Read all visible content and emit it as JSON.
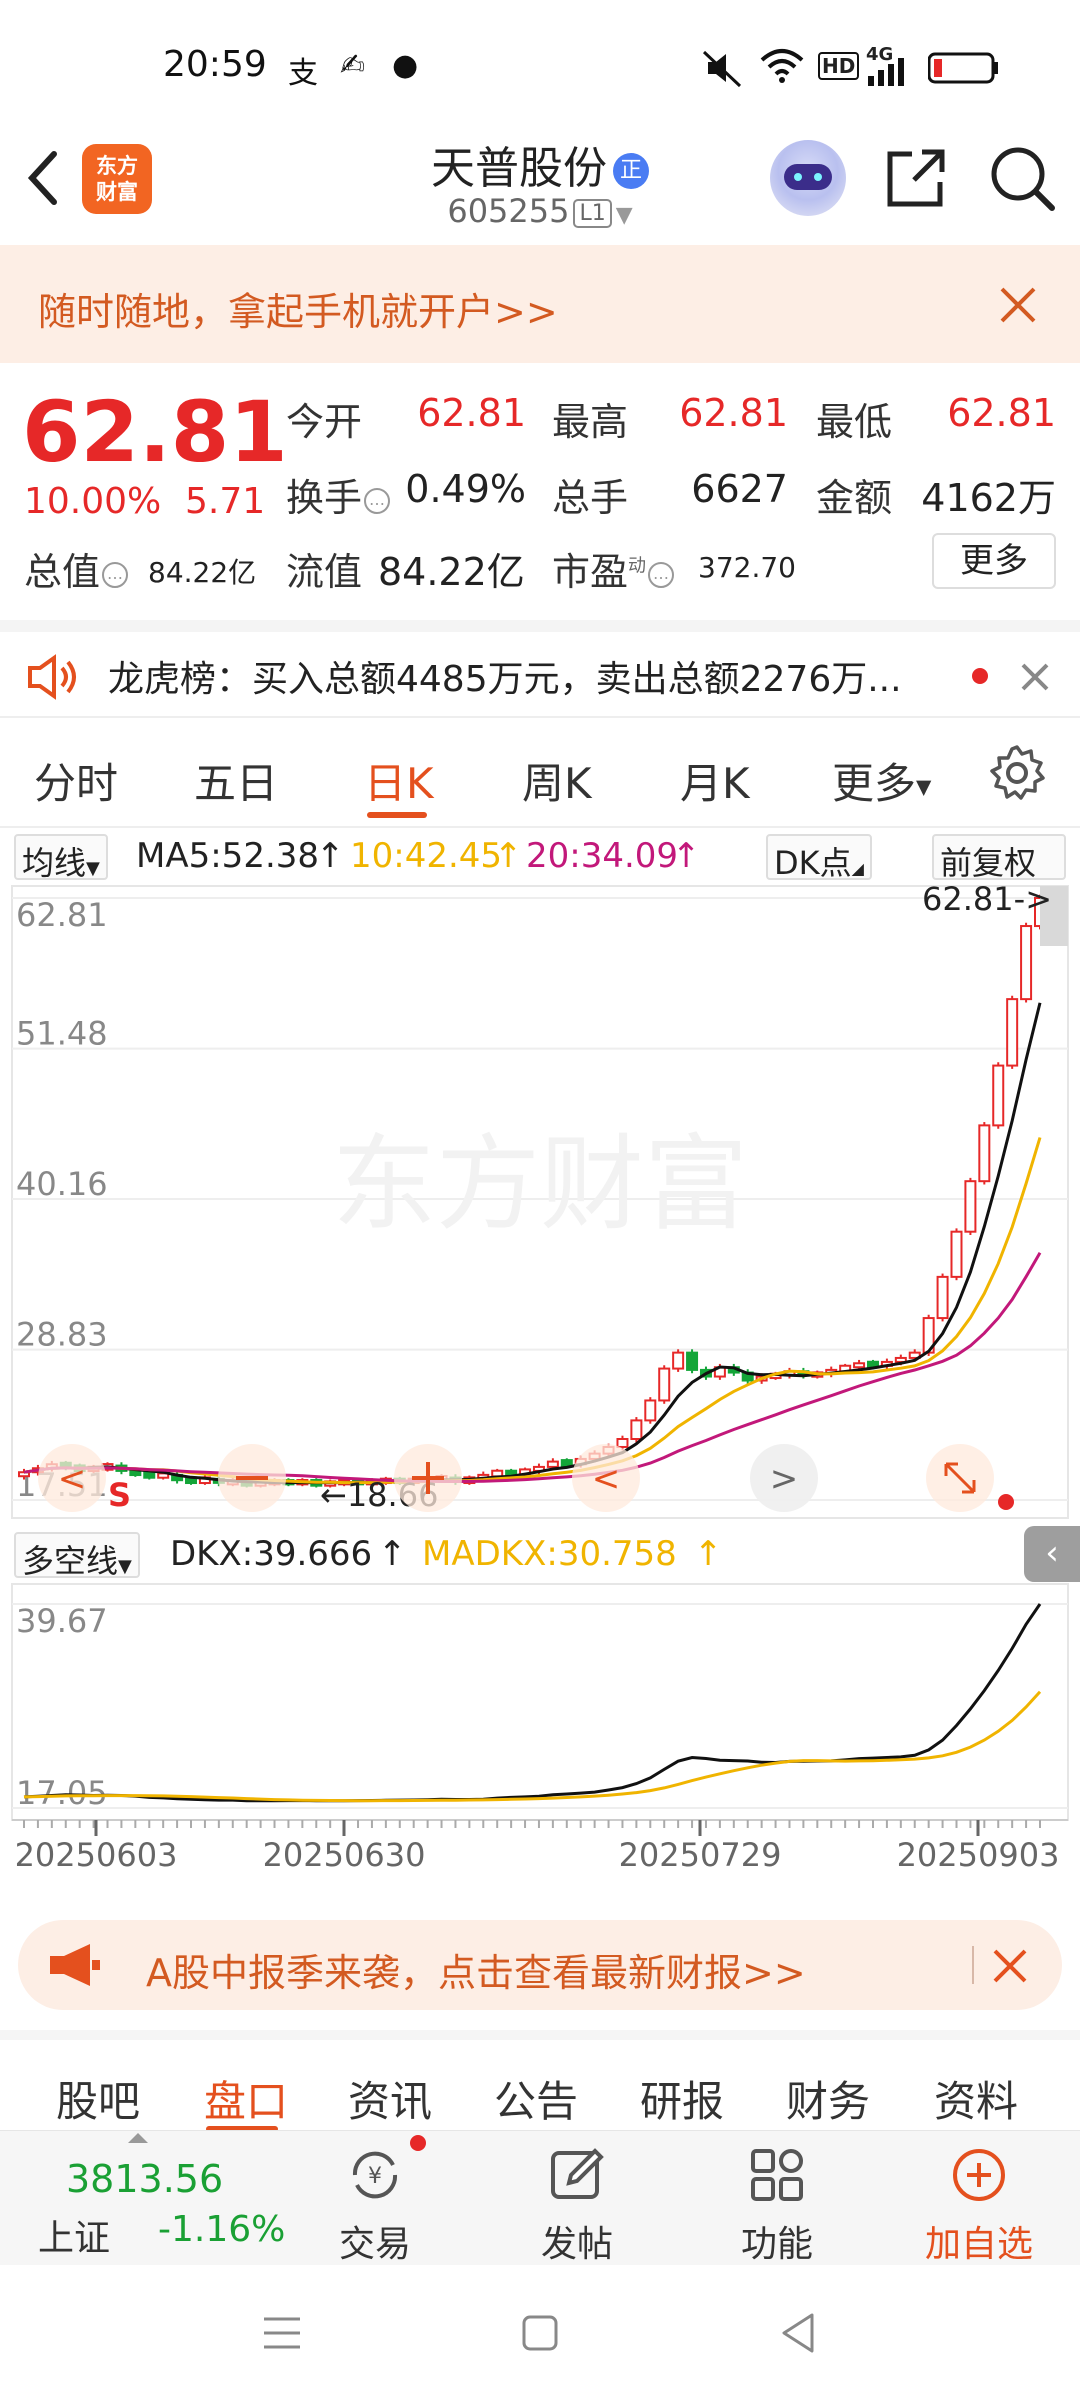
{
  "status_bar": {
    "time": "20:59",
    "network": "4G",
    "hd": "HD"
  },
  "header": {
    "logo_text": [
      "东方",
      "财富"
    ],
    "stock_name": "天普股份",
    "badge": "正",
    "stock_code": "605255",
    "level": "L1"
  },
  "banner_top": {
    "text": "随时随地，拿起手机就开户>>"
  },
  "quote": {
    "price": "62.81",
    "change_pct": "10.00%",
    "change": "5.71",
    "open_label": "今开",
    "open": "62.81",
    "high_label": "最高",
    "high": "62.81",
    "low_label": "最低",
    "low": "62.81",
    "turnover_label": "换手",
    "turnover": "0.49%",
    "volume_label": "总手",
    "volume": "6627",
    "amount_label": "金额",
    "amount": "4162万",
    "mktcap_label": "总值",
    "mktcap": "84.22亿",
    "float_label": "流值",
    "float_cap": "84.22亿",
    "pe_label": "市盈",
    "pe_sup": "动",
    "pe": "372.70",
    "more": "更多"
  },
  "ticker": {
    "text": "龙虎榜：买入总额4485万元，卖出总额2276万..."
  },
  "chart_tabs": [
    "分时",
    "五日",
    "日K",
    "周K",
    "月K",
    "更多"
  ],
  "ma_row": {
    "selector": "均线",
    "ma5": "MA5:52.38",
    "ma10": "10:42.45",
    "ma20": "20:34.09",
    "dk_button": "DK点",
    "adjust_button": "前复权"
  },
  "dkx_row": {
    "selector": "多空线",
    "dkx": "DKX:39.666",
    "madkx": "MADKX:30.758"
  },
  "chart_labels": {
    "current_tag": "62.81->",
    "min_tag": "18.66",
    "s_marker": "S",
    "watermark": "东方财富"
  },
  "chart_data": [
    {
      "type": "candlestick",
      "title": "日K",
      "y_ticks": [
        "62.81",
        "51.48",
        "40.16",
        "28.83",
        "17.51"
      ],
      "ylim": [
        17.51,
        62.81
      ],
      "series": [
        {
          "name": "MA5",
          "color": "#111111"
        },
        {
          "name": "MA10",
          "color": "#f0b400"
        },
        {
          "name": "MA20",
          "color": "#c2187a"
        }
      ],
      "close": [
        19.6,
        19.9,
        20.2,
        20.0,
        19.8,
        19.9,
        20.1,
        19.7,
        19.5,
        19.3,
        19.4,
        19.0,
        18.9,
        19.1,
        18.8,
        18.9,
        18.7,
        18.8,
        18.9,
        18.8,
        18.9,
        18.7,
        18.8,
        18.9,
        18.8,
        18.9,
        19.0,
        18.9,
        19.0,
        19.1,
        19.2,
        18.9,
        19.1,
        19.4,
        19.6,
        19.5,
        19.7,
        20.0,
        20.4,
        20.2,
        20.6,
        21.0,
        21.5,
        22.1,
        23.5,
        25.0,
        27.4,
        28.6,
        27.3,
        26.8,
        27.5,
        27.1,
        26.5,
        26.8,
        26.9,
        27.2,
        26.9,
        27.0,
        27.3,
        27.5,
        27.8,
        27.6,
        27.9,
        28.2,
        28.6,
        31.2,
        34.3,
        37.7,
        41.5,
        45.7,
        50.2,
        55.2,
        60.7,
        62.81
      ]
    },
    {
      "type": "line",
      "title": "多空线",
      "y_ticks": [
        "39.67",
        "17.05"
      ],
      "ylim": [
        17.05,
        39.67
      ],
      "x_ticks": [
        "20250603",
        "20250630",
        "20250729",
        "20250903"
      ],
      "series": [
        {
          "name": "DKX",
          "color": "#111111"
        },
        {
          "name": "MADKX",
          "color": "#f0b400"
        }
      ]
    }
  ],
  "banner_bottom": {
    "text": "A股中报季来袭，点击查看最新财报>>"
  },
  "bottom_tabs": [
    "股吧",
    "盘口",
    "资讯",
    "公告",
    "研报",
    "财务",
    "资料"
  ],
  "index_box": {
    "value": "3813.56",
    "name": "上证",
    "change": "-1.16%"
  },
  "bottom_bar": [
    "交易",
    "发帖",
    "功能",
    "加自选"
  ]
}
